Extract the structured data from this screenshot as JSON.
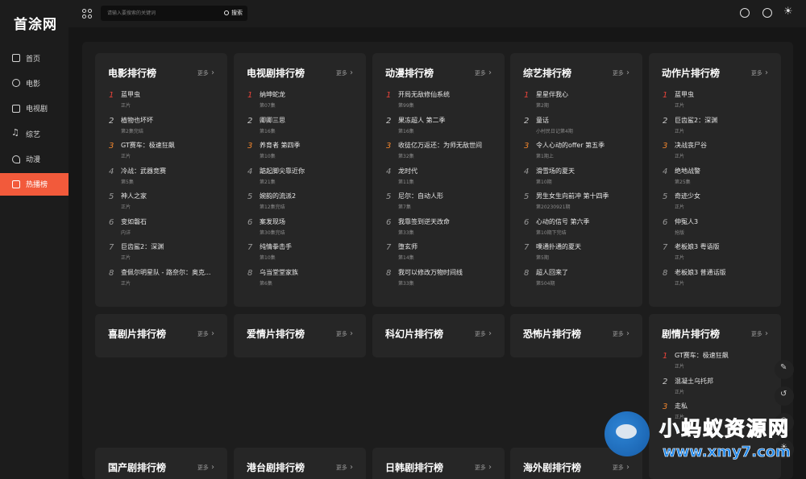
{
  "app": {
    "logo": "首涂网"
  },
  "sidebar": {
    "items": [
      {
        "label": "首页",
        "icon": "home-icon",
        "active": false
      },
      {
        "label": "电影",
        "icon": "film-reel-icon",
        "active": false
      },
      {
        "label": "电视剧",
        "icon": "tv-icon",
        "active": false
      },
      {
        "label": "综艺",
        "icon": "music-note-icon",
        "active": false
      },
      {
        "label": "动漫",
        "icon": "anime-icon",
        "active": false
      },
      {
        "label": "热播榜",
        "icon": "hot-list-icon",
        "active": true
      }
    ]
  },
  "topbar": {
    "search_placeholder": "请输入要搜索的关键词",
    "search_button": "搜索"
  },
  "more_label": "更多",
  "cards": [
    {
      "title": "电影排行榜",
      "items": [
        {
          "num": "1",
          "name": "蓝甲虫",
          "sub": "正片"
        },
        {
          "num": "2",
          "name": "植物也坏坏",
          "sub": "第2集完结"
        },
        {
          "num": "3",
          "name": "GT赛车：极速狂飙",
          "sub": "正片"
        },
        {
          "num": "4",
          "name": "冷战：武器竞赛",
          "sub": "第5集"
        },
        {
          "num": "5",
          "name": "神人之家",
          "sub": "正片"
        },
        {
          "num": "6",
          "name": "变如磐石",
          "sub": "内详"
        },
        {
          "num": "7",
          "name": "巨齿鲨2：深渊",
          "sub": "正片"
        },
        {
          "num": "8",
          "name": "查佩尔明星队 - 路奈尔：奥克...",
          "sub": "正片"
        }
      ]
    },
    {
      "title": "电视剧排行榜",
      "items": [
        {
          "num": "1",
          "name": "纳坤蛇龙",
          "sub": "第07集"
        },
        {
          "num": "2",
          "name": "卿卿三思",
          "sub": "第16集"
        },
        {
          "num": "3",
          "name": "养育者 第四季",
          "sub": "第10集"
        },
        {
          "num": "4",
          "name": "踮起脚尖靠近你",
          "sub": "第21集"
        },
        {
          "num": "5",
          "name": "婉韵的流派2",
          "sub": "第12集完结"
        },
        {
          "num": "6",
          "name": "案发现场",
          "sub": "第30集完结"
        },
        {
          "num": "7",
          "name": "纯情拳击手",
          "sub": "第10集"
        },
        {
          "num": "8",
          "name": "乌当堂堂家族",
          "sub": "第6集"
        }
      ]
    },
    {
      "title": "动漫排行榜",
      "items": [
        {
          "num": "1",
          "name": "开局无敌修仙系统",
          "sub": "第99集"
        },
        {
          "num": "2",
          "name": "果冻超人 第二季",
          "sub": "第16集"
        },
        {
          "num": "3",
          "name": "收徒亿万返还：为师无敌世间",
          "sub": "第32集"
        },
        {
          "num": "4",
          "name": "龙时代",
          "sub": "第11集"
        },
        {
          "num": "5",
          "name": "尼尔：自动人形",
          "sub": "第7集"
        },
        {
          "num": "6",
          "name": "我靠签到逆天改命",
          "sub": "第33集"
        },
        {
          "num": "7",
          "name": "堕玄师",
          "sub": "第14集"
        },
        {
          "num": "8",
          "name": "我可以修改万物时间线",
          "sub": "第33集"
        }
      ]
    },
    {
      "title": "综艺排行榜",
      "items": [
        {
          "num": "1",
          "name": "星星伴我心",
          "sub": "第2期"
        },
        {
          "num": "2",
          "name": "童话",
          "sub": "小村民日记第4期"
        },
        {
          "num": "3",
          "name": "令人心动的offer 第五季",
          "sub": "第1期上"
        },
        {
          "num": "4",
          "name": "滑雪场的夏天",
          "sub": "第10期"
        },
        {
          "num": "5",
          "name": "男生女生向前冲 第十四季",
          "sub": "第20230921期"
        },
        {
          "num": "6",
          "name": "心动的信号 第六季",
          "sub": "第10期下完结"
        },
        {
          "num": "7",
          "name": "噗通扑通的夏天",
          "sub": "第5期"
        },
        {
          "num": "8",
          "name": "超人回来了",
          "sub": "第504期"
        }
      ]
    },
    {
      "title": "动作片排行榜",
      "items": [
        {
          "num": "1",
          "name": "蓝甲虫",
          "sub": "正片"
        },
        {
          "num": "2",
          "name": "巨齿鲨2：深渊",
          "sub": "正片"
        },
        {
          "num": "3",
          "name": "决战丧尸谷",
          "sub": "正片"
        },
        {
          "num": "4",
          "name": "绝地战警",
          "sub": "第25集"
        },
        {
          "num": "5",
          "name": "奇迹少女",
          "sub": "正片"
        },
        {
          "num": "6",
          "name": "伸冤人3",
          "sub": "抢版"
        },
        {
          "num": "7",
          "name": "老板娘3 粤语版",
          "sub": "正片"
        },
        {
          "num": "8",
          "name": "老板娘3 普通话版",
          "sub": "正片"
        }
      ]
    },
    {
      "title": "喜剧片排行榜",
      "items": []
    },
    {
      "title": "爱情片排行榜",
      "items": []
    },
    {
      "title": "科幻片排行榜",
      "items": []
    },
    {
      "title": "恐怖片排行榜",
      "items": []
    },
    {
      "title": "剧情片排行榜",
      "items": [
        {
          "num": "1",
          "name": "GT赛车：极速狂飙",
          "sub": "正片"
        },
        {
          "num": "2",
          "name": "混凝土乌托邦",
          "sub": "正片"
        },
        {
          "num": "3",
          "name": "走私",
          "sub": "正片"
        }
      ]
    },
    {
      "title": "国产剧排行榜",
      "items": []
    },
    {
      "title": "港台剧排行榜",
      "items": []
    },
    {
      "title": "日韩剧排行榜",
      "items": []
    },
    {
      "title": "海外剧排行榜",
      "items": []
    }
  ],
  "watermark": {
    "title": "小蚂蚁资源网",
    "url": "www.xmy7.com"
  },
  "colors": {
    "accent": "#f25a3b",
    "rank1": "#e8433a",
    "rank3": "#f0852d",
    "watermark": "#1f86e8"
  }
}
